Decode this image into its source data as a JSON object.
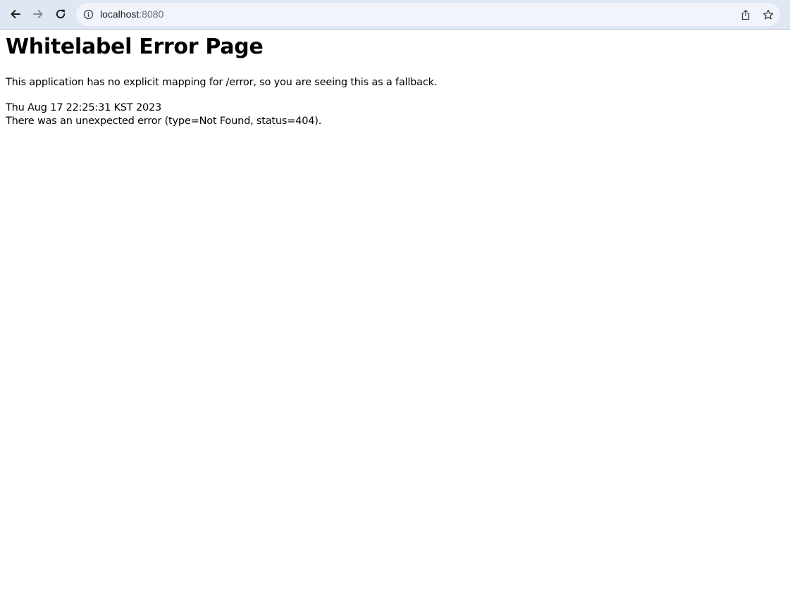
{
  "browser": {
    "url_host": "localhost",
    "url_port": ":8080",
    "icons": {
      "back": "back-arrow-icon",
      "forward": "forward-arrow-icon",
      "reload": "reload-icon",
      "site_info": "info-icon",
      "share": "share-icon",
      "bookmark": "star-icon"
    },
    "colors": {
      "toolbar_bg": "#dfe6f4",
      "omnibox_bg": "#f1f4fa"
    }
  },
  "page": {
    "title": "Whitelabel Error Page",
    "message": "This application has no explicit mapping for /error, so you are seeing this as a fallback.",
    "timestamp": "Thu Aug 17 22:25:31 KST 2023",
    "error_line": "There was an unexpected error (type=Not Found, status=404)."
  }
}
